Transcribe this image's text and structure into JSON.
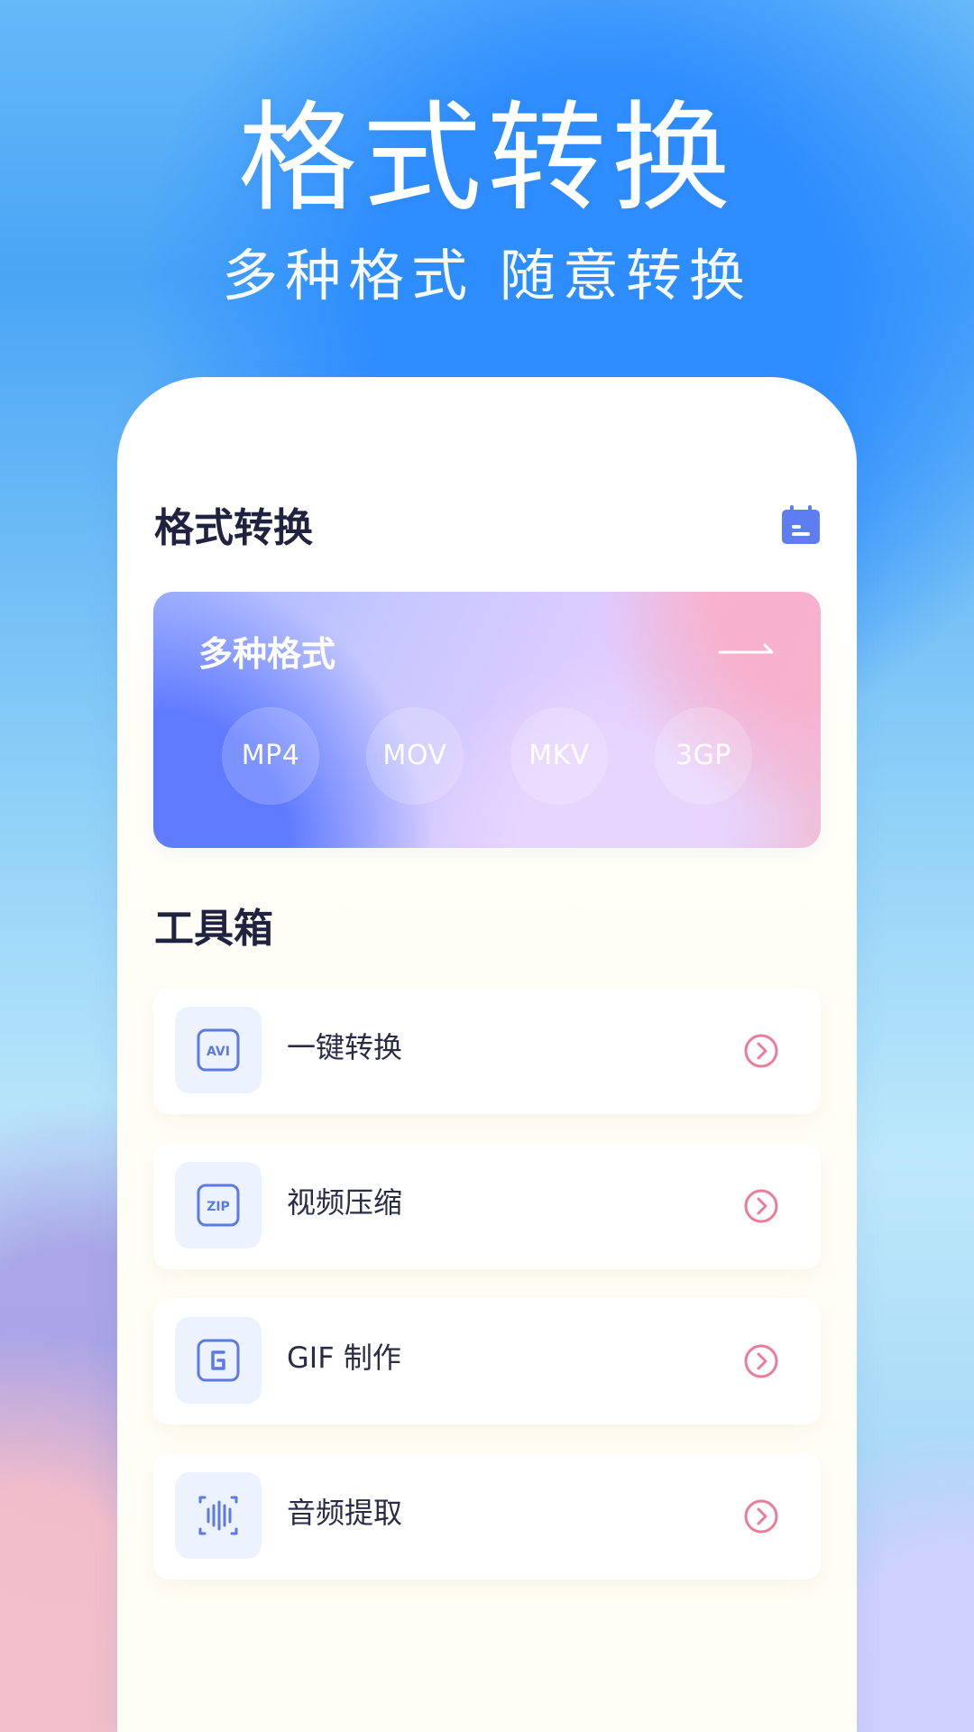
{
  "hero": {
    "title": "格式转换",
    "subtitle": "多种格式 随意转换"
  },
  "card": {
    "title": "格式转换",
    "calendar_icon": "calendar-icon",
    "banner": {
      "title": "多种格式",
      "arrow_icon": "arrow-right-icon",
      "formats": [
        "MP4",
        "MOV",
        "MKV",
        "3GP"
      ]
    },
    "toolbox_title": "工具箱",
    "tools": [
      {
        "label": "一键转换",
        "icon": "avi-icon"
      },
      {
        "label": "视频压缩",
        "icon": "zip-icon"
      },
      {
        "label": "GIF 制作",
        "icon": "gif-icon"
      },
      {
        "label": "音频提取",
        "icon": "audio-waveform-icon"
      }
    ]
  },
  "colors": {
    "accent_blue": "#5b7be8",
    "arrow_pink": "#ea7c98",
    "text_dark": "#1f2340"
  }
}
